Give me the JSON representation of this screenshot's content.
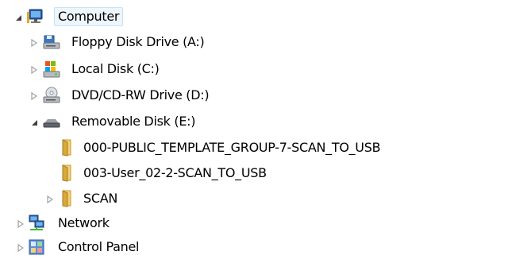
{
  "tree": {
    "computer": {
      "label": "Computer",
      "expanded": true,
      "selected": true,
      "icon": "computer-icon"
    },
    "floppy": {
      "label": "Floppy Disk Drive (A:)",
      "expanded": false,
      "icon": "floppy-drive-icon"
    },
    "local_disk": {
      "label": "Local Disk (C:)",
      "expanded": false,
      "icon": "local-disk-icon"
    },
    "dvd": {
      "label": "DVD/CD-RW Drive (D:)",
      "expanded": false,
      "icon": "dvd-drive-icon"
    },
    "removable": {
      "label": "Removable Disk (E:)",
      "expanded": true,
      "icon": "removable-disk-icon"
    },
    "folder_public": {
      "label": "000-PUBLIC_TEMPLATE_GROUP-7-SCAN_TO_USB",
      "icon": "folder-icon"
    },
    "folder_user": {
      "label": "003-User_02-2-SCAN_TO_USB",
      "icon": "folder-icon"
    },
    "folder_scan": {
      "label": "SCAN",
      "expanded": false,
      "icon": "folder-icon"
    },
    "network": {
      "label": "Network",
      "expanded": false,
      "icon": "network-icon"
    },
    "control_panel": {
      "label": "Control Panel",
      "expanded": false,
      "icon": "control-panel-icon"
    }
  },
  "colors": {
    "selection_bg": "#eef6fd",
    "selection_border": "#c7e2f6",
    "arrow": "#a0a0a0",
    "folder": "#e8c25a"
  }
}
